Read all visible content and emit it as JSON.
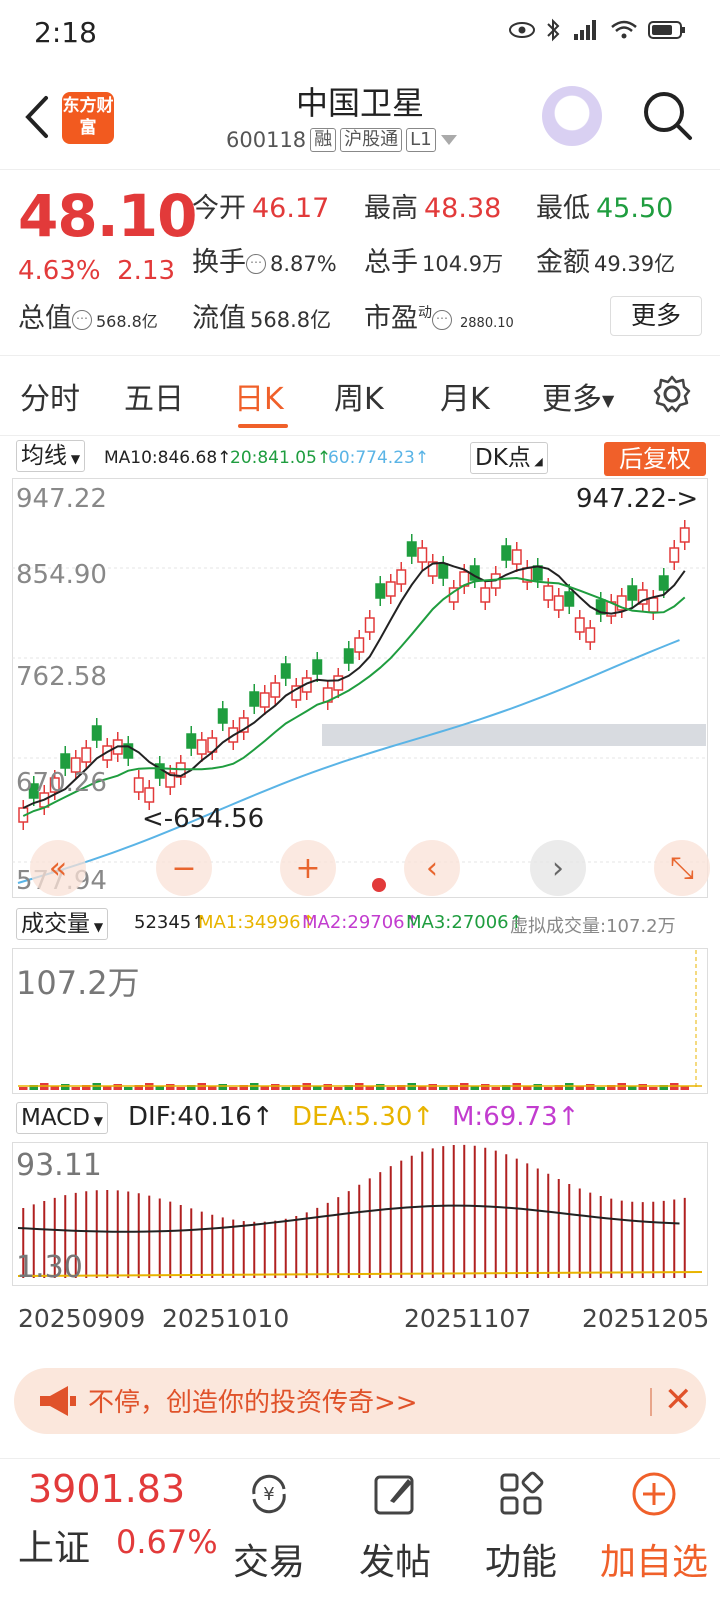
{
  "status": {
    "time": "2:18"
  },
  "header": {
    "logo": "东方财富",
    "title": "中国卫星",
    "code": "600118",
    "tags": [
      "融",
      "沪股通",
      "L1"
    ]
  },
  "quote": {
    "price": "48.10",
    "change_pct": "4.63%",
    "change": "2.13",
    "open_label": "今开",
    "open": "46.17",
    "high_label": "最高",
    "high": "48.38",
    "low_label": "最低",
    "low": "45.50",
    "turnover_label": "换手",
    "turnover": "8.87%",
    "volume_label": "总手",
    "volume": "104.9万",
    "amount_label": "金额",
    "amount": "49.39亿",
    "mktcap_label": "总值",
    "mktcap": "568.8亿",
    "float_label": "流值",
    "float": "568.8亿",
    "pe_label": "市盈",
    "pe_super": "动",
    "pe": "2880.10",
    "more": "更多"
  },
  "tabs": [
    "分时",
    "五日",
    "日K",
    "周K",
    "月K",
    "更多"
  ],
  "active_tab": "日K",
  "kline": {
    "indicator": "均线",
    "ma10": "MA10:846.68↑",
    "ma20": "20:841.05↑",
    "ma60": "60:774.23↑",
    "dk": "DK点",
    "fq": "后复权",
    "y_labels": [
      "947.22",
      "854.90",
      "762.58",
      "670.26",
      "577.94"
    ],
    "max_mark": "947.22->",
    "min_mark": "<-654.56"
  },
  "volume": {
    "indicator": "成交量",
    "val": "52345↑",
    "ma1": "MA1:34996↑",
    "ma2": "MA2:29706↑",
    "ma3": "MA3:27006↑",
    "virtual": "虚拟成交量:107.2万",
    "top": "107.2万"
  },
  "macd": {
    "indicator": "MACD",
    "dif": "DIF:40.16↑",
    "dea": "DEA:5.30↑",
    "m": "M:69.73↑",
    "top": "93.11",
    "bottom": "1.30"
  },
  "x_labels": [
    "20250909",
    "20251010",
    "20251107",
    "20251205"
  ],
  "banner": {
    "text": "不停，创造你的投资传奇>>"
  },
  "index": {
    "value": "3901.83",
    "name": "上证",
    "change": "0.67%"
  },
  "nav": [
    "交易",
    "发帖",
    "功能",
    "加自选"
  ],
  "colors": {
    "accent": "#f0602a",
    "up": "#e23a3a",
    "down": "#1f9d3f",
    "ma10": "#222222",
    "ma20": "#1f9d3f",
    "ma60": "#5ab4e6",
    "dea": "#e8b400",
    "m": "#c23ccf"
  }
}
